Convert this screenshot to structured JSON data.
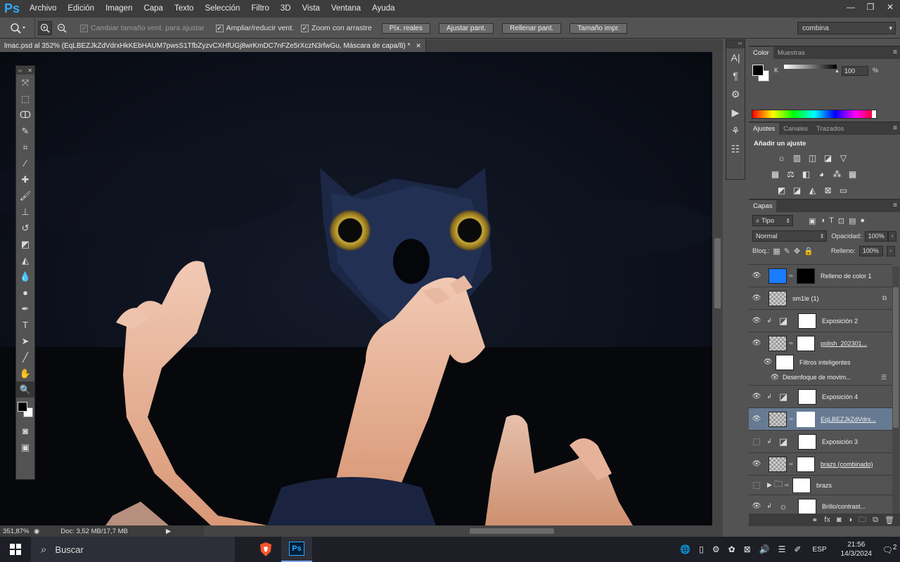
{
  "app": {
    "logo": "Ps"
  },
  "menu": [
    "Archivo",
    "Edición",
    "Imagen",
    "Capa",
    "Texto",
    "Selección",
    "Filtro",
    "3D",
    "Vista",
    "Ventana",
    "Ayuda"
  ],
  "window_controls": {
    "minimize": "—",
    "restore": "❐",
    "close": "✕"
  },
  "options": {
    "resize_windows": "Cambiar tamaño vent. para ajustar",
    "zoom_windows": "Ampliar/reducir vent.",
    "scrubby_zoom": "Zoom con arrastre",
    "btn_actual": "Píx. reales",
    "btn_fit": "Ajustar pant.",
    "btn_fill": "Rellenar pant.",
    "btn_print": "Tamaño impr.",
    "workspace": "combina"
  },
  "document": {
    "tab_title": "lmac.psd al 352% (EqLBEZJkZdVdrxHkKEbHAUM7pwsS1TfbZyzvCXHfUGj8wrKmDC7nFZe5rXczN3rfwGu, Máscara de capa/8) *",
    "zoom": "351,87%",
    "doc_size": "Doc: 3,52 MB/17,7 MB"
  },
  "panels": {
    "color_tabs": [
      "Color",
      "Muestras"
    ],
    "color_channel": "K",
    "color_value": "100",
    "color_unit": "%",
    "adjust_tabs": [
      "Ajustes",
      "Canales",
      "Trazados"
    ],
    "adjust_title": "Añadir un ajuste",
    "layers_tab": "Capas",
    "filter_kind": "Tipo",
    "blend_mode": "Normal",
    "opacity_label": "Opacidad:",
    "opacity": "100%",
    "lock_label": "Bloq.:",
    "fill_label": "Relleno:",
    "fill": "100%"
  },
  "layers": [
    {
      "name": "Relleno de color 1"
    },
    {
      "name": "sm1le (1)"
    },
    {
      "name": "Exposición 2"
    },
    {
      "name": "polish_202301..."
    },
    {
      "name": "Filtros inteligentes"
    },
    {
      "name": "Desenfoque de movim..."
    },
    {
      "name": "Exposición 4"
    },
    {
      "name": "EqLBEZJkZdVdrx..."
    },
    {
      "name": "Exposición 3"
    },
    {
      "name": "brazs (combinado)"
    },
    {
      "name": "brazs"
    },
    {
      "name": "Brillo/contrast..."
    }
  ],
  "colors": {
    "fill_layer": "#1a7cff",
    "accent": "#31a8ff"
  },
  "taskbar": {
    "search": "Buscar",
    "lang": "ESP",
    "time": "21:56",
    "date": "14/3/2024",
    "notifications": "2"
  }
}
